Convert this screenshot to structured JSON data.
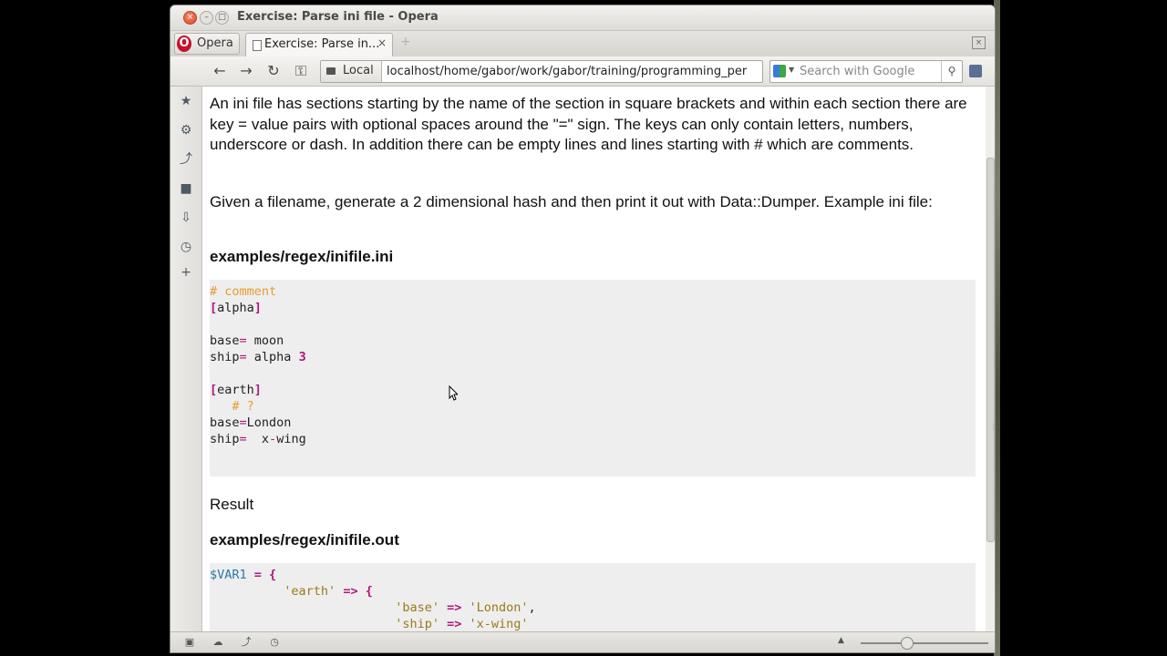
{
  "window": {
    "title": "Exercise: Parse ini file - Opera",
    "close_glyph": "×",
    "min_glyph": "–",
    "max_glyph": "□"
  },
  "tabs": {
    "opera_menu_label": "Opera",
    "active_tab_label": "Exercise: Parse in...",
    "close_glyph": "×",
    "new_tab_glyph": "+"
  },
  "toolbar": {
    "local_label": "Local",
    "address": "localhost/home/gabor/work/gabor/training/programming_per",
    "search_placeholder": "Search with Google"
  },
  "content": {
    "intro_paragraph": "An ini file has sections starting by the name of the section in square brackets and within each section there are key = value pairs with optional spaces around the \"=\" sign. The keys can only contain letters, numbers, underscore or dash. In addition there can be empty lines and lines starting with # which are comments.",
    "task_paragraph": "Given a filename, generate a 2 dimensional hash and then print it out with Data::Dumper. Example ini file:",
    "ini_heading": "examples/regex/inifile.ini",
    "result_label": "Result",
    "out_heading": "examples/regex/inifile.out"
  },
  "ini_code": {
    "comment": "# comment",
    "alpha_section": "alpha",
    "alpha_base_key": "base",
    "alpha_base_value": " moon",
    "alpha_ship_key": "ship",
    "alpha_ship_value": " alpha ",
    "alpha_ship_num": "3",
    "earth_section": "earth",
    "earth_comment": "   # ?",
    "earth_base_key": "base",
    "earth_base_value": "London",
    "earth_ship_key": "ship",
    "earth_ship_value": "  x",
    "earth_ship_value2": "wing"
  },
  "out_code": {
    "var": "$VAR1",
    "earth_key": "'earth'",
    "base_key": "'base'",
    "base_value": "'London'",
    "ship_key": "'ship'",
    "ship_value": "'x-wing'"
  }
}
